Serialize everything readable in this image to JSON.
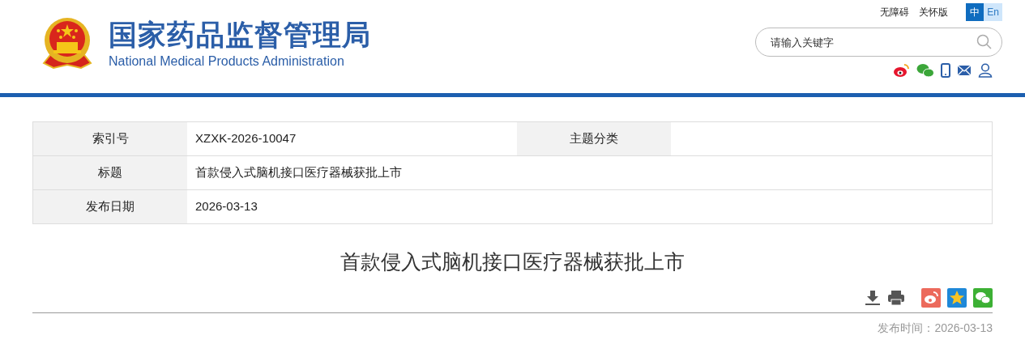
{
  "header": {
    "title": "国家药品监督管理局",
    "subtitle": "National Medical Products Administration"
  },
  "top_links": [
    "无障碍",
    "关怀版"
  ],
  "languages": [
    {
      "label": "中",
      "selected": true
    },
    {
      "label": "En",
      "selected": false
    }
  ],
  "search": {
    "placeholder": "请输入关键字"
  },
  "info_table": {
    "rows": [
      {
        "cells": [
          {
            "kind": "label",
            "text": "索引号"
          },
          {
            "kind": "value",
            "text": "XZXK-2026-10047"
          },
          {
            "kind": "label",
            "text": "主题分类"
          },
          {
            "kind": "value",
            "text": ""
          }
        ]
      },
      {
        "cells": [
          {
            "kind": "label",
            "text": "标题"
          },
          {
            "kind": "value",
            "text": "首款侵入式脑机接口医疗器械获批上市"
          }
        ]
      },
      {
        "cells": [
          {
            "kind": "label",
            "text": "发布日期"
          },
          {
            "kind": "value",
            "text": "2026-03-13"
          }
        ]
      }
    ]
  },
  "article": {
    "title": "首款侵入式脑机接口医疗器械获批上市",
    "publish_time": "发布时间：2026-03-13"
  }
}
